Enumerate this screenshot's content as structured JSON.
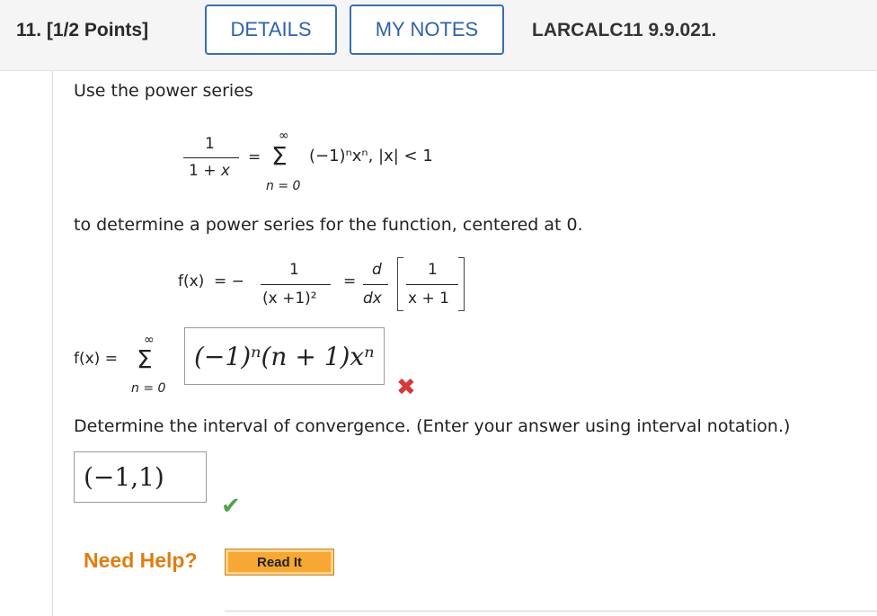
{
  "header": {
    "question_number": "11.",
    "points": "[1/2 Points]",
    "details_label": "DETAILS",
    "my_notes_label": "MY NOTES",
    "question_id": "LARCALC11 9.9.021."
  },
  "body": {
    "intro": "Use the power series",
    "series": {
      "numerator": "1",
      "denominator": "1 + x",
      "equals": "=",
      "sum_upper": "∞",
      "sum_lower": "n = 0",
      "term": "(−1)ⁿxⁿ,  |x| < 1"
    },
    "instruction": "to determine a power series for the function, centered at 0.",
    "function": {
      "fx": "f(x)",
      "eq_minus": "=  −",
      "num1": "1",
      "den1": "(x +1)²",
      "equals": "=",
      "d_num": "d",
      "d_den": "dx",
      "inner_num": "1",
      "inner_den": "x + 1"
    },
    "answer1": {
      "fx_eq": "f(x)  =",
      "sum_upper": "∞",
      "sum_lower": "n = 0",
      "value": "(−1)ⁿ(n + 1)xⁿ",
      "status": "incorrect"
    },
    "convergence_prompt": "Determine the interval of convergence. (Enter your answer using interval notation.)",
    "answer2": {
      "value": "(−1,1)",
      "status": "correct"
    }
  },
  "help": {
    "label": "Need Help?",
    "read_it": "Read It"
  },
  "colors": {
    "button_blue": "#2f63a8",
    "help_orange": "#e07d10",
    "incorrect_red": "#d63a3a",
    "correct_green": "#4ea54a"
  }
}
